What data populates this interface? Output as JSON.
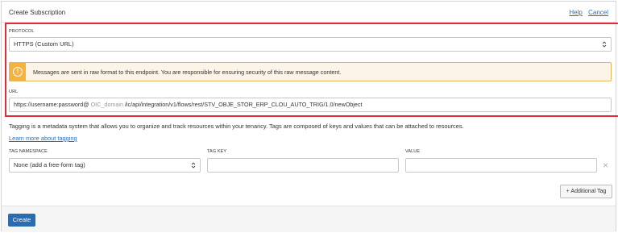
{
  "header": {
    "title": "Create Subscription",
    "help_label": "Help",
    "cancel_label": "Cancel"
  },
  "protocol": {
    "label": "PROTOCOL",
    "value": "HTTPS (Custom URL)"
  },
  "alert": {
    "icon": "warning-icon",
    "icon_glyph": "!",
    "message": "Messages are sent in raw format to this endpoint. You are responsible for ensuring security of this raw message content."
  },
  "url": {
    "label": "URL",
    "value_prefix": "https://username:password@",
    "value_redacted": " OIC_domain ",
    "value_suffix": "/ic/api/integration/v1/flows/rest/STV_OBJE_STOR_ERP_CLOU_AUTO_TRIG/1.0/newObject"
  },
  "tagging": {
    "info": "Tagging is a metadata system that allows you to organize and track resources within your tenancy. Tags are composed of keys and values that can be attached to resources.",
    "learn_more": "Learn more about tagging",
    "namespace_label": "TAG NAMESPACE",
    "namespace_value": "None (add a free-form tag)",
    "key_label": "TAG KEY",
    "key_value": "",
    "value_label": "VALUE",
    "value_value": "",
    "clear_glyph": "×",
    "add_tag_label": "+ Additional Tag"
  },
  "footer": {
    "create_label": "Create"
  },
  "colors": {
    "highlight_border": "#e02d3a",
    "link": "#2a6fb5",
    "primary_button": "#2b6cb0",
    "warning": "#f4b33f"
  }
}
